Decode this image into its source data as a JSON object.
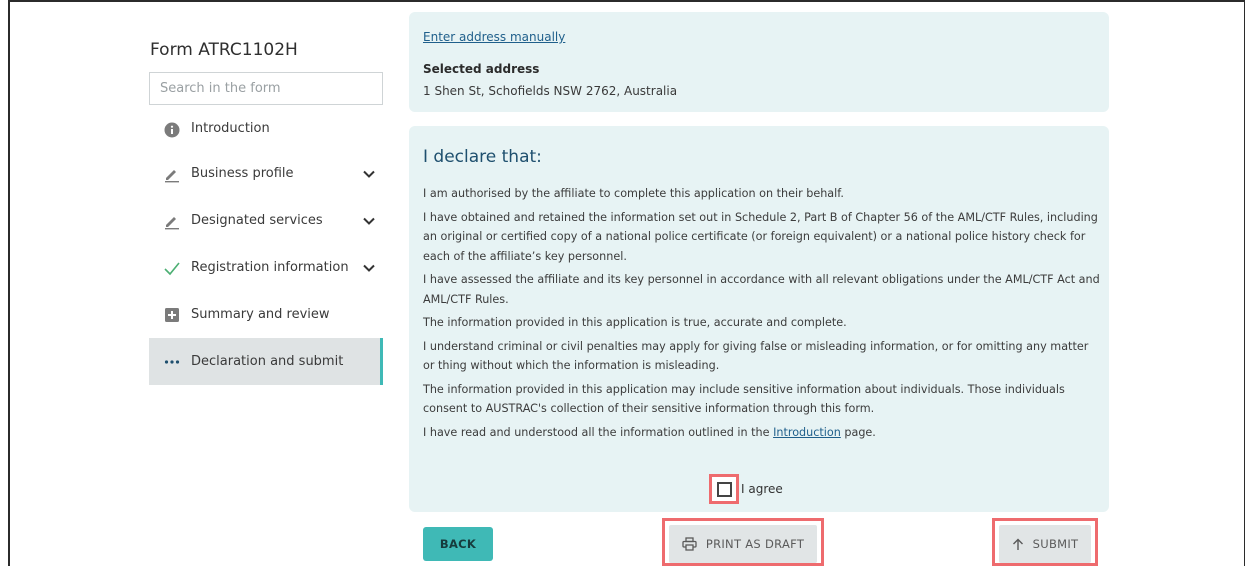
{
  "sidebar": {
    "form_title": "Form ATRC1102H",
    "search_placeholder": "Search in the form",
    "items": [
      {
        "label": "Introduction",
        "icon": "info-icon"
      },
      {
        "label": "Business profile",
        "icon": "pencil-icon"
      },
      {
        "label": "Designated services",
        "icon": "pencil-icon"
      },
      {
        "label": "Registration information",
        "icon": "check-icon"
      },
      {
        "label": "Summary and review",
        "icon": "summary-icon"
      },
      {
        "label": "Declaration and submit",
        "icon": "ellipsis-icon"
      }
    ]
  },
  "address": {
    "manual_link": "Enter address manually",
    "selected_label": "Selected address",
    "selected_value": "1 Shen St, Schofields NSW 2762, Australia"
  },
  "declaration": {
    "title": "I declare that:",
    "statements": [
      "I am authorised by the affiliate to complete this application on their behalf.",
      "I have obtained and retained the information set out in Schedule 2, Part B of Chapter 56 of the AML/CTF Rules, including an original or certified copy of a national police certificate (or foreign equivalent) or a national police history check for each of the affiliate’s key personnel.",
      "I have assessed the affiliate and its key personnel in accordance with all relevant obligations under the AML/CTF Act and AML/CTF Rules.",
      "The information provided in this application is true, accurate and complete.",
      "I understand criminal or civil penalties may apply for giving false or misleading information, or for omitting any matter or thing without which the information is misleading.",
      "The information provided in this application may include sensitive information about individuals. Those individuals consent to AUSTRAC's collection of their sensitive information through this form."
    ],
    "last_prefix": "I have read and understood all the information outlined in the ",
    "last_link": "Introduction",
    "last_suffix": " page.",
    "agree_label": "I agree",
    "agree_checked": false
  },
  "actions": {
    "back": "BACK",
    "print_draft": "PRINT AS DRAFT",
    "submit": "SUBMIT"
  },
  "colors": {
    "accent": "#3fb9b6",
    "highlight": "#ee6b6e",
    "card_bg": "#e7f3f4",
    "title_blue": "#1e4f6e"
  }
}
